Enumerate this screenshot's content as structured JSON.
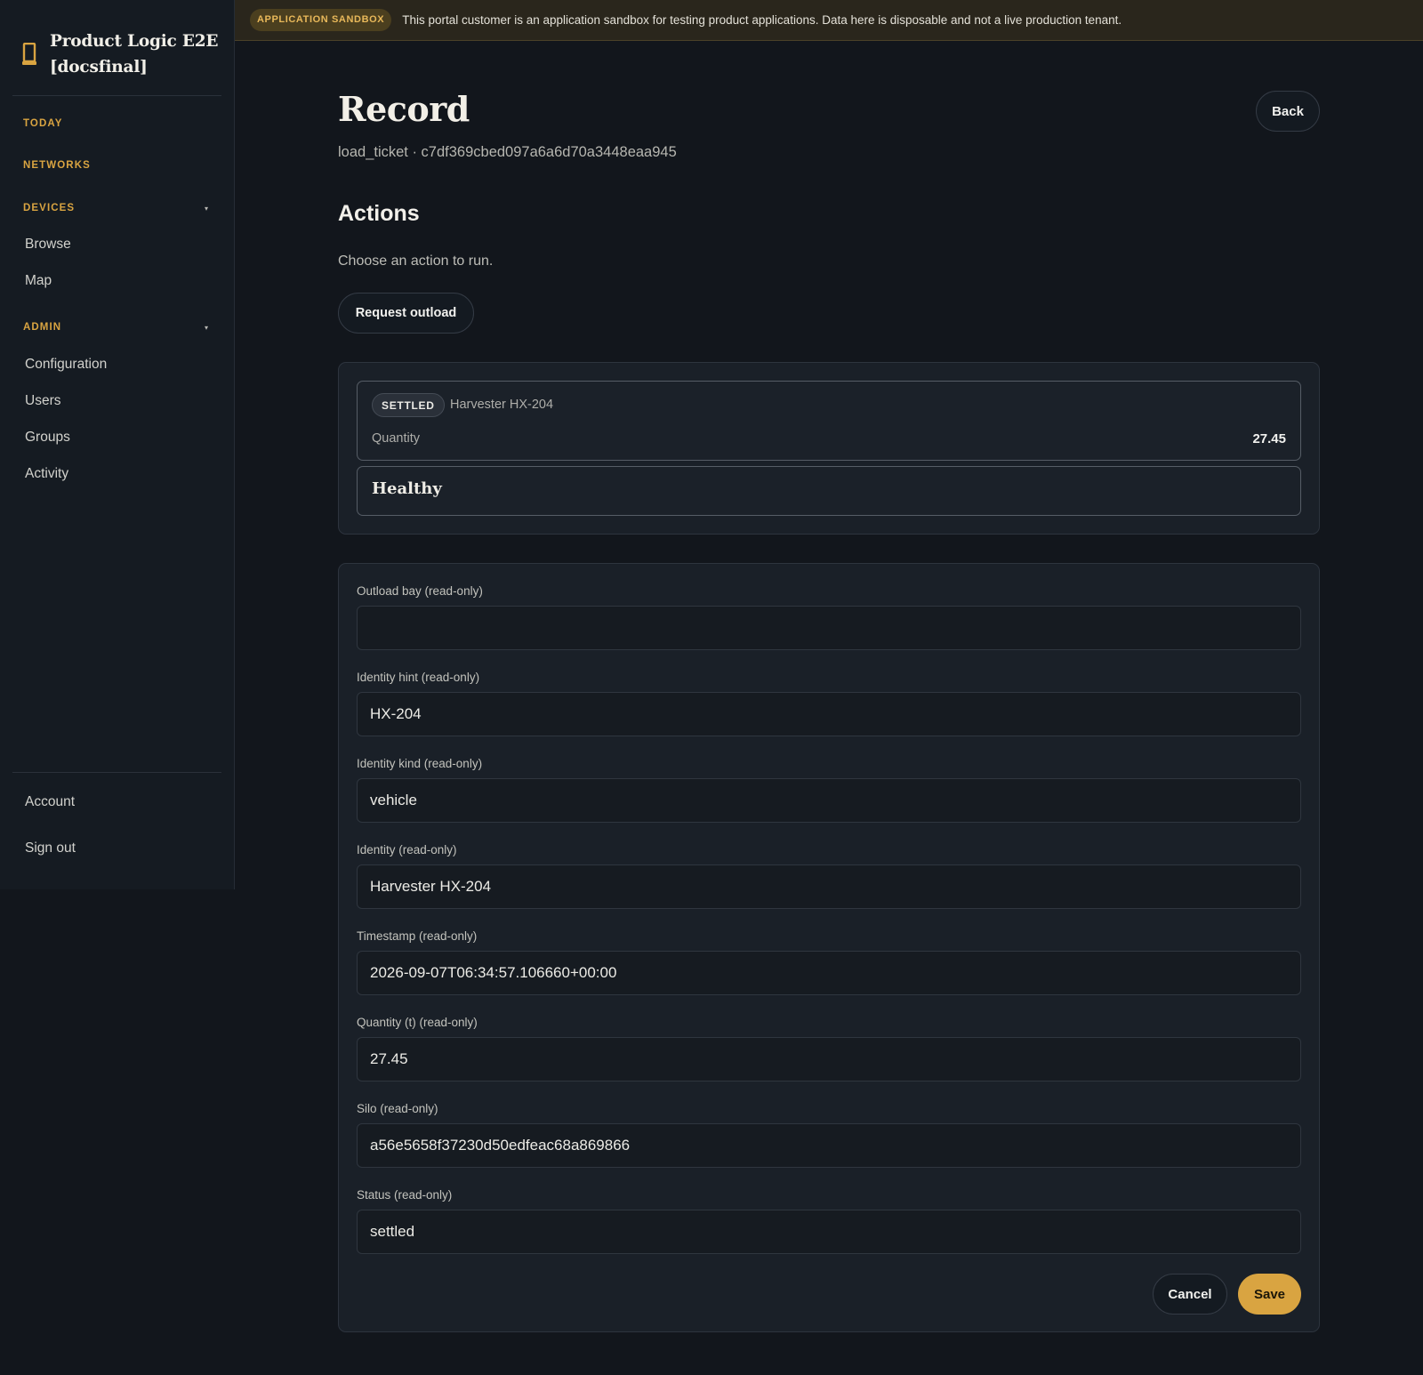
{
  "brand": {
    "title_line1": "Product Logic E2E",
    "title_line2": "[docsfinal]",
    "icon": "tablet-icon"
  },
  "sidebar": {
    "today": "TODAY",
    "networks": "NETWORKS",
    "devices": {
      "label": "DEVICES",
      "caret": "▾",
      "items": [
        "Browse",
        "Map"
      ]
    },
    "admin": {
      "label": "ADMIN",
      "caret": "▾",
      "items": [
        "Configuration",
        "Users",
        "Groups",
        "Activity"
      ]
    },
    "account": "Account",
    "sign_out": "Sign out"
  },
  "banner": {
    "badge": "APPLICATION SANDBOX",
    "text": "This portal customer is an application sandbox for testing product applications. Data here is disposable and not a live production tenant."
  },
  "header": {
    "title": "Record",
    "subtitle": "load_ticket · c7df369cbed097a6a6d70a3448eaa945",
    "back_label": "Back"
  },
  "actions": {
    "title": "Actions",
    "description": "Choose an action to run.",
    "request_outload_label": "Request outload"
  },
  "summary": {
    "status_chip": "SETTLED",
    "name": "Harvester HX-204",
    "quantity_label": "Quantity",
    "quantity_value": "27.45",
    "health": "Healthy"
  },
  "form": {
    "fields": [
      {
        "label": "Outload bay (read-only)",
        "value": ""
      },
      {
        "label": "Identity hint (read-only)",
        "value": "HX-204"
      },
      {
        "label": "Identity kind (read-only)",
        "value": "vehicle"
      },
      {
        "label": "Identity (read-only)",
        "value": "Harvester HX-204"
      },
      {
        "label": "Timestamp (read-only)",
        "value": "2026-09-07T06:34:57.106660+00:00"
      },
      {
        "label": "Quantity (t) (read-only)",
        "value": "27.45"
      },
      {
        "label": "Silo (read-only)",
        "value": "a56e5658f37230d50edfeac68a869866"
      },
      {
        "label": "Status (read-only)",
        "value": "settled"
      }
    ],
    "cancel_label": "Cancel",
    "save_label": "Save"
  },
  "colors": {
    "accent": "#d9a441",
    "background": "#12161c",
    "sidebar": "#151b22",
    "panel": "#1a2028",
    "banner": "#2a261c"
  }
}
